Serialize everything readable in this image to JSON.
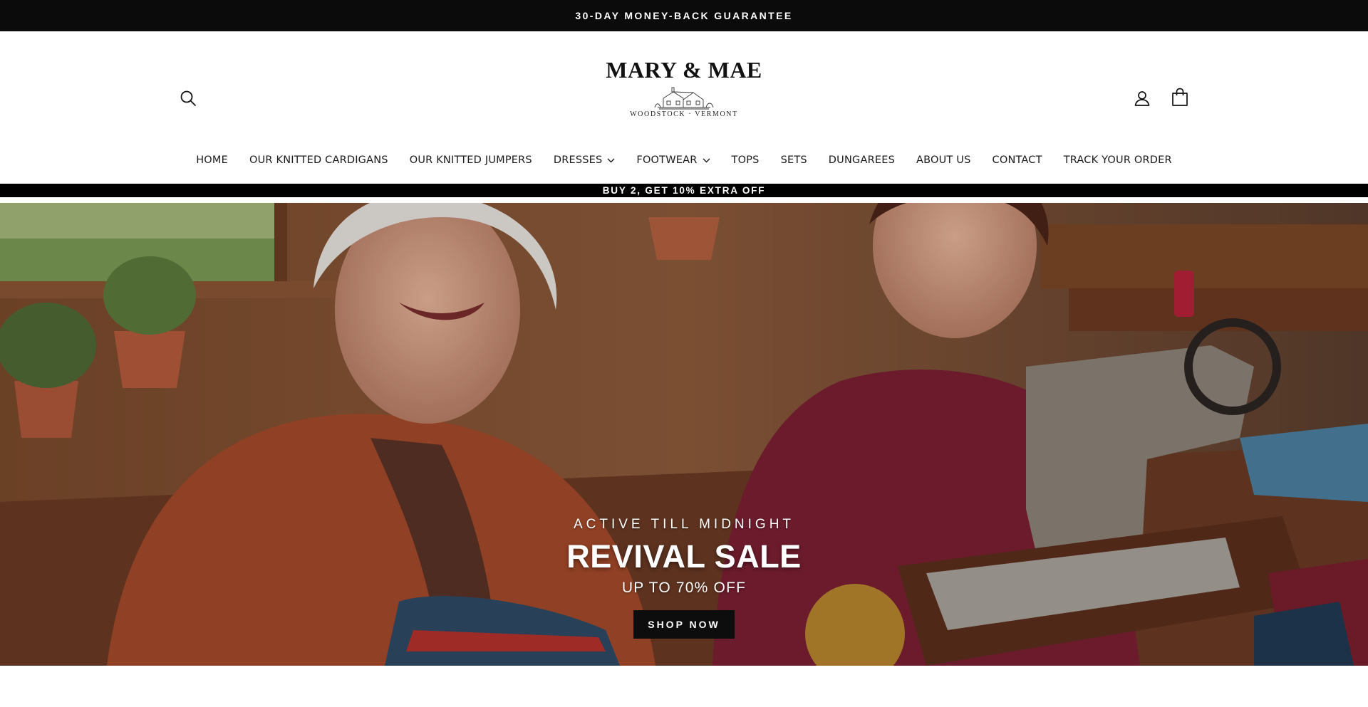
{
  "announcement": {
    "text": "30-DAY MONEY-BACK GUARANTEE"
  },
  "header": {
    "logo": {
      "title": "MARY & MAE",
      "subtitle": "WOODSTOCK · VERMONT"
    },
    "icons": {
      "search": "search-icon",
      "account": "user-icon",
      "cart": "shopping-bag-icon"
    }
  },
  "nav": {
    "items": [
      {
        "label": "HOME"
      },
      {
        "label": "OUR KNITTED CARDIGANS"
      },
      {
        "label": "OUR KNITTED JUMPERS"
      },
      {
        "label": "DRESSES",
        "dropdown": true
      },
      {
        "label": "FOOTWEAR",
        "dropdown": true
      },
      {
        "label": "TOPS"
      },
      {
        "label": "SETS"
      },
      {
        "label": "DUNGAREES"
      },
      {
        "label": "ABOUT US"
      },
      {
        "label": "CONTACT"
      },
      {
        "label": "TRACK YOUR ORDER"
      }
    ]
  },
  "promo": {
    "text": "BUY 2, GET 10% EXTRA OFF"
  },
  "hero": {
    "eyebrow": "ACTIVE TILL MIDNIGHT",
    "title": "REVIVAL SALE",
    "subtitle": "UP TO 70% OFF",
    "cta": "SHOP NOW"
  },
  "colors": {
    "bar_bg": "#0b0b0b",
    "text": "#1a1a1a",
    "button_bg": "#0d0d0d"
  }
}
